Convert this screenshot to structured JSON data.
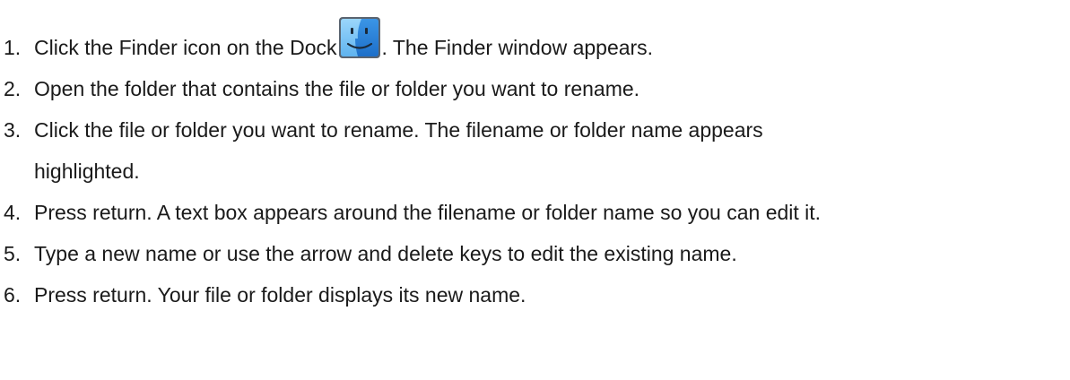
{
  "steps": [
    {
      "number": "1.",
      "before_icon": "Click the Finder icon on the Dock",
      "icon": "finder-icon",
      "after_icon": ". The Finder window appears."
    },
    {
      "number": "2.",
      "text": "Open the folder that contains the file or folder you want to rename."
    },
    {
      "number": "3.",
      "line1": "Click the file or folder you want to rename. The filename or folder name appears",
      "line2": "highlighted."
    },
    {
      "number": "4.",
      "text": "Press return. A text box appears around the filename or folder name so you can edit it."
    },
    {
      "number": "5.",
      "text": "Type a new name or use the arrow and delete keys to edit the existing name."
    },
    {
      "number": "6.",
      "text": "Press return. Your file or folder displays its new name."
    }
  ],
  "colors": {
    "text": "#1a1a1a",
    "finder_light": "#7fc6f5",
    "finder_dark": "#2a7fd6"
  }
}
